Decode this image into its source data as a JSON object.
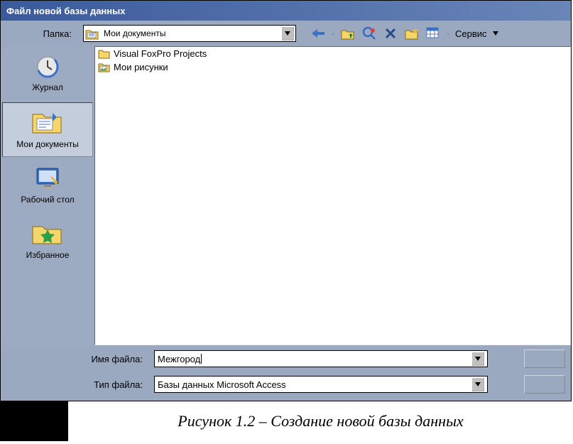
{
  "window": {
    "title": "Файл новой базы данных"
  },
  "toolbar": {
    "folder_label": "Папка:",
    "current_folder": "Мои документы",
    "service_label": "Сервис"
  },
  "places": [
    {
      "id": "history",
      "label": "Журнал",
      "selected": false
    },
    {
      "id": "mydocs",
      "label": "Мои документы",
      "selected": true
    },
    {
      "id": "desktop",
      "label": "Рабочий стол",
      "selected": false
    },
    {
      "id": "favorites",
      "label": "Избранное",
      "selected": false
    }
  ],
  "files": [
    {
      "name": "Visual FoxPro Projects",
      "icon": "folder"
    },
    {
      "name": "Мои рисунки",
      "icon": "picture-folder"
    }
  ],
  "fields": {
    "filename_label": "Имя файла:",
    "filename_value": "Межгород",
    "filetype_label": "Тип файла:",
    "filetype_value": "Базы данных Microsoft Access"
  },
  "caption": "Рисунок 1.2 – Создание новой базы данных"
}
